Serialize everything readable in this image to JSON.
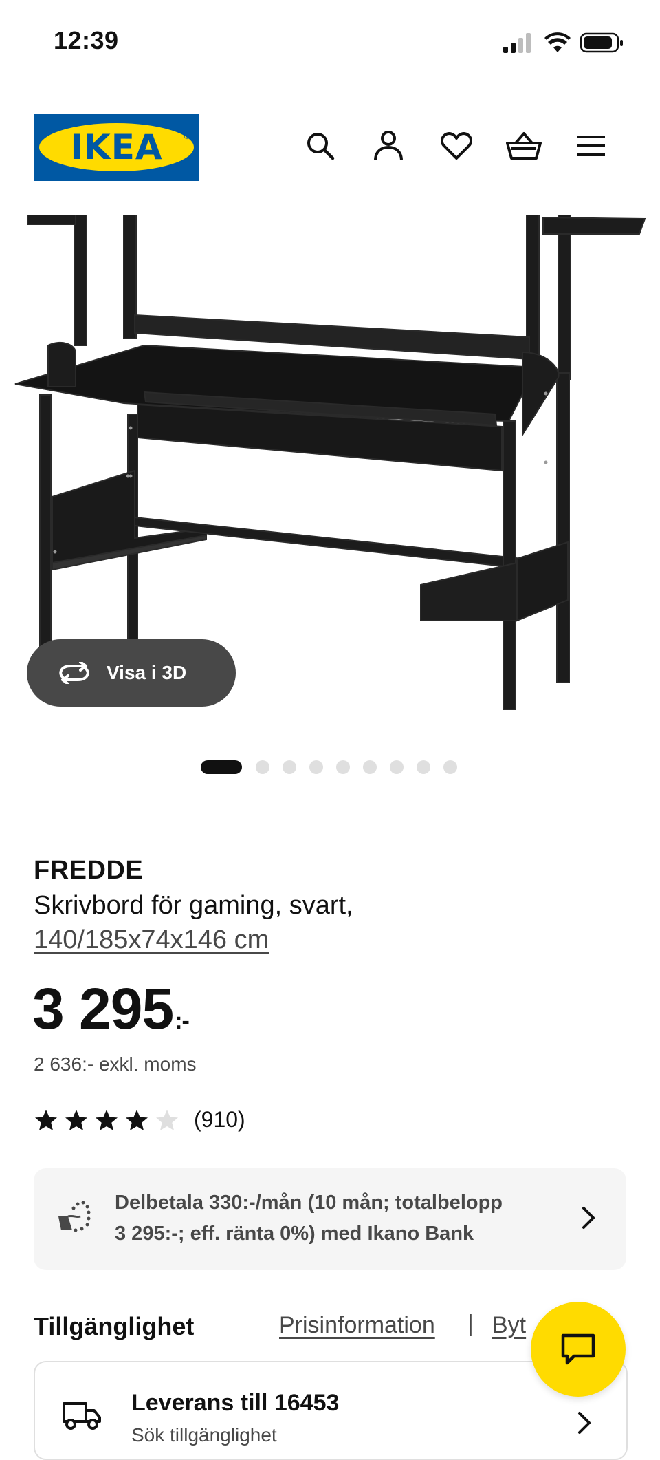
{
  "status_bar": {
    "time": "12:39"
  },
  "header": {
    "logo_text": "IKEA",
    "icons": [
      "search-icon",
      "user-icon",
      "heart-icon",
      "basket-icon",
      "menu-icon"
    ]
  },
  "gallery": {
    "view_3d_label": "Visa i 3D",
    "dot_count": 9,
    "active_dot": 1
  },
  "product": {
    "name": "FREDDE",
    "description": "Skrivbord för gaming, svart,",
    "dimensions": "140/185x74x146 cm",
    "price": "3 295",
    "price_suffix": ":-",
    "price_excl_vat": "2 636:- exkl. moms",
    "rating": 4.5,
    "rating_count": "(910)"
  },
  "finance": {
    "line1": "Delbetala 330:-/mån (10 mån; totalbelopp",
    "line2": "3 295:-; eff. ränta 0%) med Ikano Bank"
  },
  "availability": {
    "title": "Tillgänglighet",
    "price_info_link": "Prisinformation",
    "separator": "|",
    "change_link": "Byt",
    "delivery_title": "Leverans till 16453",
    "delivery_sub": "Sök tillgänglighet"
  },
  "colors": {
    "ikea_blue": "#0058a3",
    "ikea_yellow": "#ffdb00",
    "text_dark": "#111111",
    "text_muted": "#484848",
    "panel_bg": "#f5f5f5"
  }
}
